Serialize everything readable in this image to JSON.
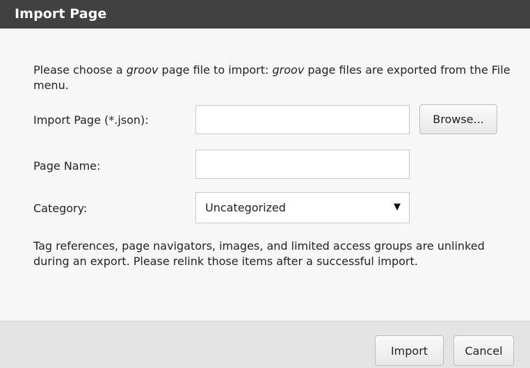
{
  "dialog": {
    "title": "Import Page",
    "intro": {
      "part1": "Please choose a ",
      "brand1": "groov",
      "part2": " page file to import: ",
      "brand2": "groov",
      "part3": " page files are exported from the File menu."
    },
    "import_field": {
      "label": "Import Page (*.json):",
      "value": "",
      "browse_label": "Browse..."
    },
    "name_field": {
      "label": "Page Name:",
      "value": ""
    },
    "category_field": {
      "label": "Category:",
      "selected": "Uncategorized"
    },
    "note": "Tag references, page navigators, images, and limited access groups are unlinked during an export. Please relink those items after a successful import.",
    "buttons": {
      "import_label": "Import",
      "cancel_label": "Cancel"
    }
  }
}
